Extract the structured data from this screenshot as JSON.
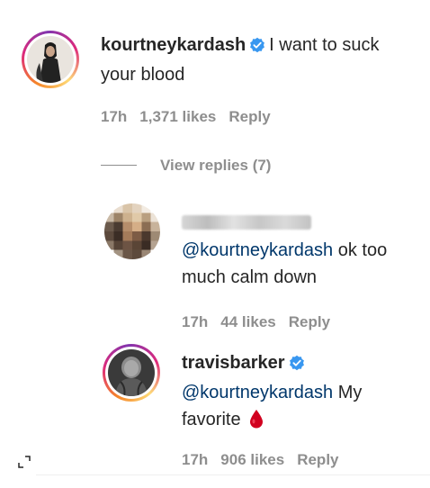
{
  "comments": [
    {
      "username": "kourtneykardash",
      "verified": true,
      "text": "I want to suck your blood",
      "time": "17h",
      "likes": "1,371 likes",
      "reply": "Reply"
    }
  ],
  "view_replies": "View replies (7)",
  "replies": [
    {
      "username": "",
      "mention": "@kourtneykardash",
      "text": "ok too much calm down",
      "time": "17h",
      "likes": "44 likes",
      "reply": "Reply"
    },
    {
      "username": "travisbarker",
      "verified": true,
      "mention": "@kourtneykardash",
      "text": "My favorite",
      "emoji": "drop-of-blood",
      "time": "17h",
      "likes": "906 likes",
      "reply": "Reply"
    }
  ],
  "colors": {
    "mention": "#00376b",
    "verified": "#3897f0",
    "meta": "#8e8e8e",
    "blood": "#d1001f"
  },
  "icons": [
    "verified-badge-icon",
    "blood-drop-icon",
    "expand-icon"
  ]
}
